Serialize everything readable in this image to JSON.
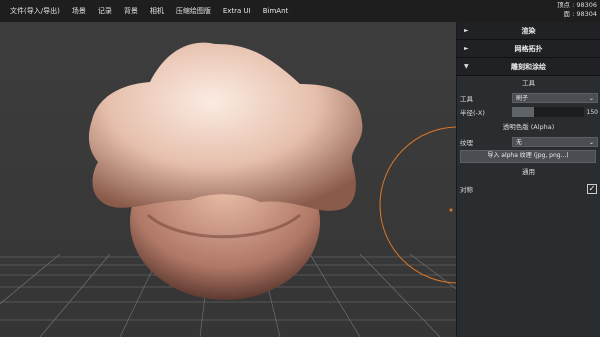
{
  "menu": [
    "文件(导入/导出)",
    "场景",
    "记录",
    "背景",
    "相机",
    "压缩绘图版",
    "Extra UI",
    "BimAnt"
  ],
  "stats": {
    "vertices": "顶点 : 98306",
    "faces": "面 : 98304"
  },
  "panel": {
    "sections": [
      {
        "label": "渲染",
        "arrow": "►"
      },
      {
        "label": "网格拓扑",
        "arrow": "►"
      },
      {
        "label": "雕刻和涂绘",
        "arrow": "▼"
      }
    ],
    "tools_title": "工具",
    "tool_label": "工具",
    "tool_value": "刷子",
    "radius_label": "半径(-X)",
    "radius_value": "150",
    "radius_fraction": 0.3,
    "alpha_title": "透明色版 (Alpha)",
    "texture_label": "纹理",
    "texture_value": "无",
    "import_button": "导入 alpha 纹理 (jpg, png...)",
    "general_title": "通用",
    "symmetry_label": "对称",
    "symmetry_checked": true,
    "check_mark": "✓"
  },
  "colors": {
    "panel_bg": "#2a2d30",
    "viewport_bg": "#3c3c3c",
    "brush_ring": "#d9772a",
    "skin": "#e7c1ae"
  },
  "icons": {
    "collapsed": "triangle-right-icon",
    "expanded": "triangle-down-icon",
    "dropdown": "chevron-down-icon"
  }
}
